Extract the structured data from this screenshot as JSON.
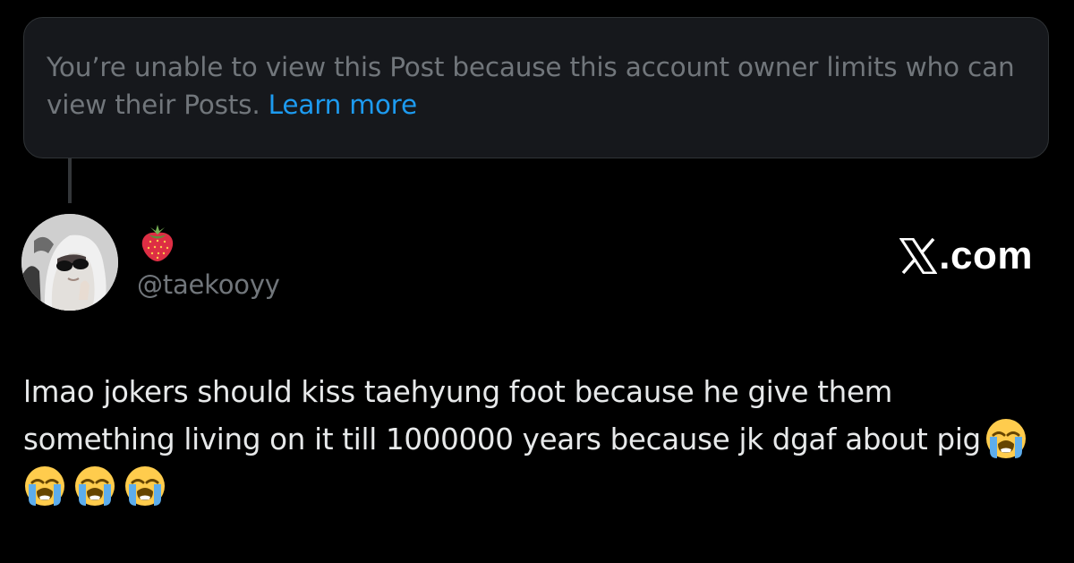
{
  "notice": {
    "text": "You’re unable to view this Post because this account owner limits who can view their Posts. ",
    "link_label": "Learn more"
  },
  "author": {
    "display_name_icon": "strawberry-emoji",
    "handle": "@taekooyy"
  },
  "brand": {
    "label": ".com",
    "icon": "x-logo"
  },
  "post": {
    "text": "lmao jokers should kiss taehyung foot because he give them something living on it till 1000000 years because jk dgaf about pig",
    "emojis": [
      "loudly-crying-face",
      "loudly-crying-face",
      "loudly-crying-face",
      "loudly-crying-face"
    ]
  },
  "colors": {
    "background": "#000000",
    "notice_background": "#16181c",
    "muted_text": "#71767b",
    "link": "#1d9bf0",
    "body_text": "#e7e9ea"
  }
}
